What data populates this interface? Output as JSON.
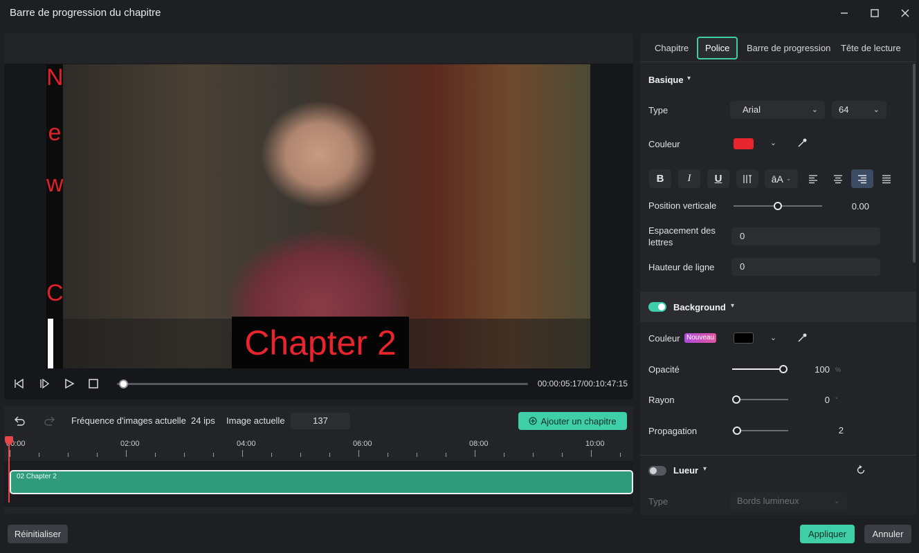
{
  "window": {
    "title": "Barre de progression du chapitre",
    "minimize_icon": "minimize-icon",
    "maximize_icon": "maximize-icon",
    "close_icon": "close-icon"
  },
  "preview": {
    "strip_letters": [
      "N",
      "e",
      "w",
      "C"
    ],
    "overlay_text": "Chapter 2",
    "timecode": "00:00:05:17/00:10:47:15",
    "scrub_progress": 0.012
  },
  "timeline": {
    "fps_label": "Fréquence d'images actuelle",
    "fps_value": "24 ips",
    "frame_label": "Image actuelle",
    "frame_value": "137",
    "add_chapter_label": "Ajouter un chapitre",
    "ruler_labels": [
      "00:00",
      "02:00",
      "04:00",
      "06:00",
      "08:00",
      "10:00"
    ],
    "clip_label": "02 Chapter 2"
  },
  "panel": {
    "tabs": [
      "Chapitre",
      "Police",
      "Barre de progression",
      "Tête de lecture"
    ],
    "active_tab": "Police",
    "basic": {
      "header": "Basique",
      "type_label": "Type",
      "font_value": "Arial",
      "size_value": "64",
      "color_label": "Couleur",
      "color_value": "#e8242c",
      "vpos_label": "Position verticale",
      "vpos_value": "0.00",
      "spacing_label_1": "Espacement des",
      "spacing_label_2": "lettres",
      "spacing_value": "0",
      "line_height_label": "Hauteur de ligne",
      "line_height_value": "0"
    },
    "background": {
      "header": "Background",
      "enabled": true,
      "color_label": "Couleur",
      "new_badge": "Nouveau",
      "color_value": "#000000",
      "opacity_label": "Opacité",
      "opacity_value": "100",
      "opacity_unit": "%",
      "radius_label": "Rayon",
      "radius_value": "0",
      "radius_unit": "°",
      "spread_label": "Propagation",
      "spread_value": "2"
    },
    "glow": {
      "header": "Lueur",
      "enabled": false,
      "type_label": "Type",
      "type_value": "Bords lumineux"
    }
  },
  "footer": {
    "reset_label": "Réinitialiser",
    "apply_label": "Appliquer",
    "cancel_label": "Annuler"
  },
  "colors": {
    "accent": "#3ecfa8",
    "clip": "#2e9c7b",
    "playhead": "#e8454a"
  }
}
